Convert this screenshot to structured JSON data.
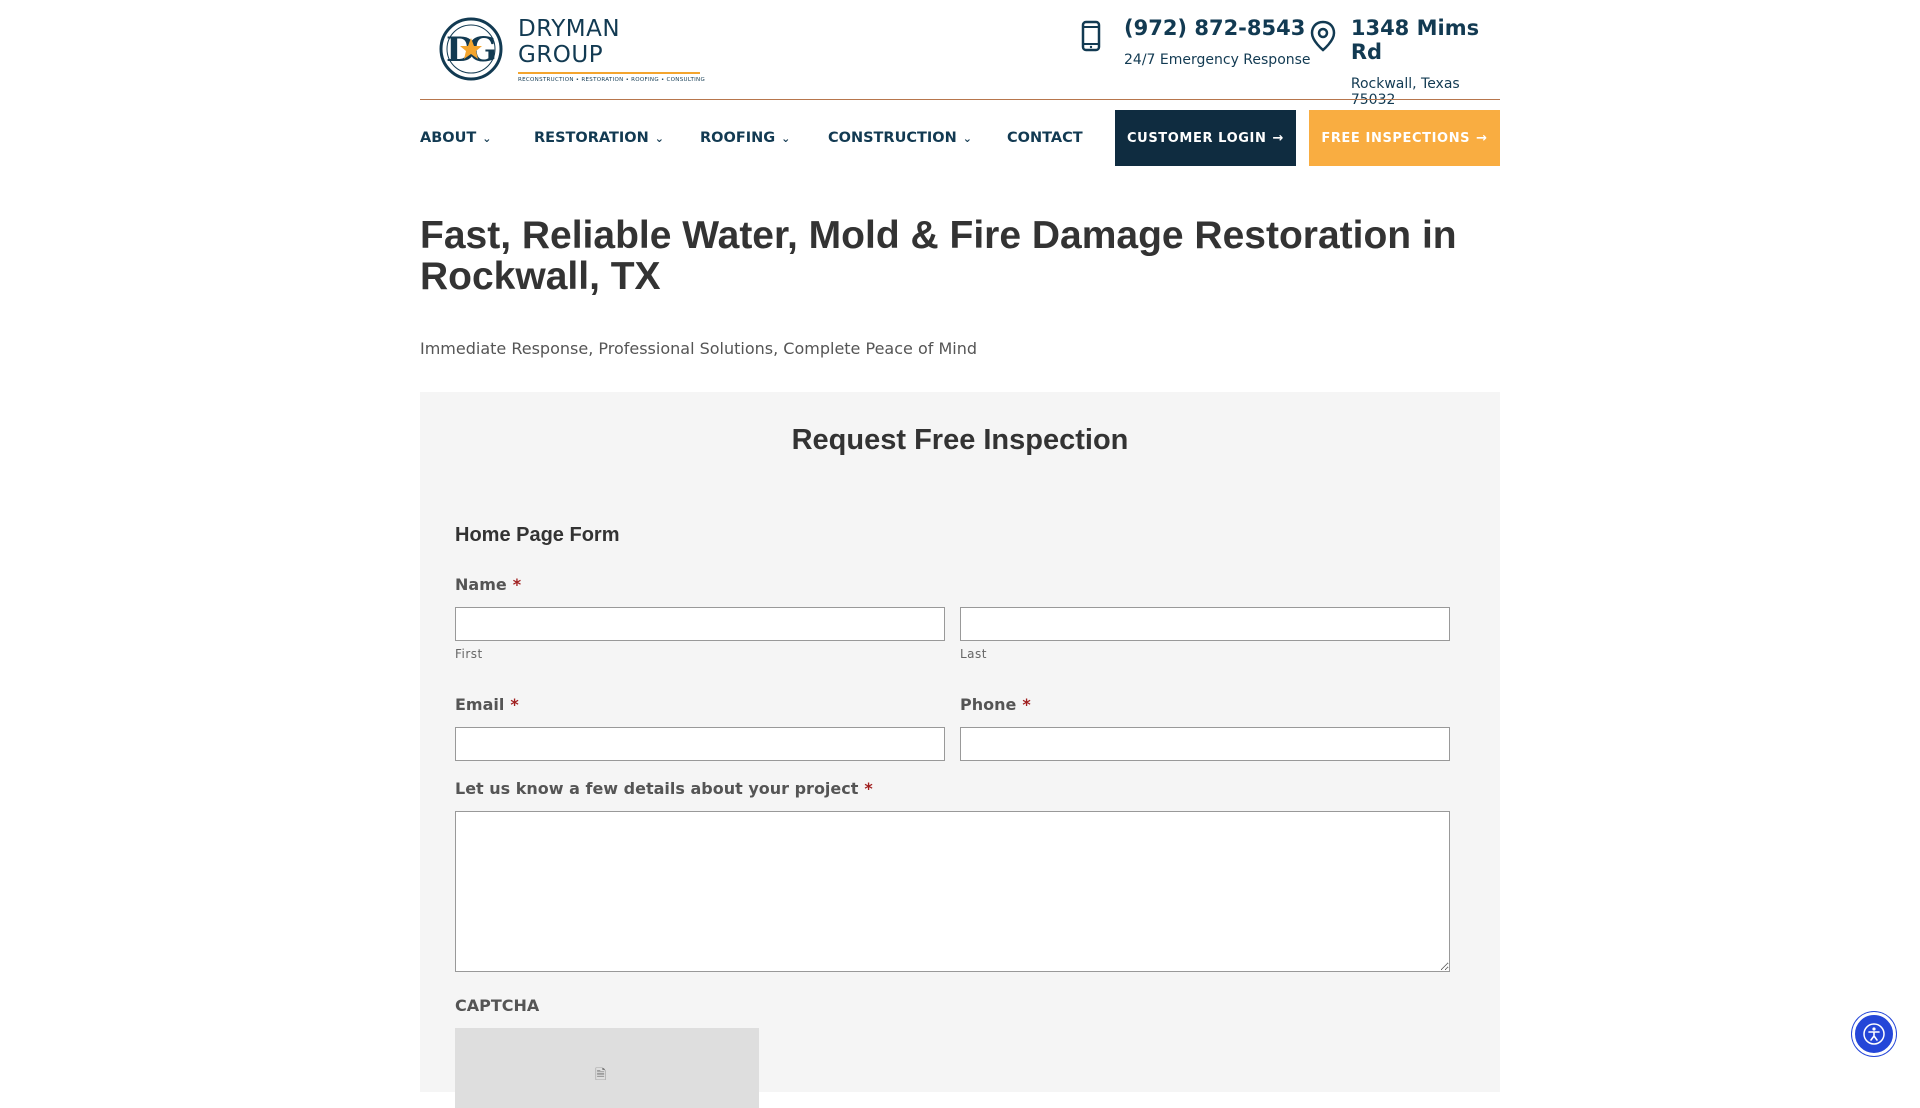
{
  "brand": {
    "name": "DRYMAN GROUP",
    "tagline": "RECONSTRUCTION • RESTORATION • ROOFING • CONSULTING",
    "monogram": "DG",
    "colors": {
      "navy": "#123a52",
      "orange": "#f9ad41",
      "dark_button": "#0f2c40",
      "accessibility_blue": "#2446d8"
    }
  },
  "header": {
    "phone": {
      "number": "(972) 872-8543",
      "sub": "24/7 Emergency Response",
      "icon": "phone-icon"
    },
    "address": {
      "line1": "1348 Mims Rd",
      "line2": "Rockwall, Texas 75032",
      "icon": "map-pin-icon"
    }
  },
  "nav": {
    "items": [
      {
        "label": "ABOUT",
        "has_dropdown": true
      },
      {
        "label": "RESTORATION",
        "has_dropdown": true
      },
      {
        "label": "ROOFING",
        "has_dropdown": true
      },
      {
        "label": "CONSTRUCTION",
        "has_dropdown": true
      },
      {
        "label": "CONTACT",
        "has_dropdown": false
      }
    ],
    "chevron": "⌄",
    "login_button": "CUSTOMER LOGIN",
    "free_button": "FREE INSPECTIONS",
    "arrow": "→"
  },
  "hero": {
    "title": "Fast, Reliable Water, Mold & Fire Damage Restoration in Rockwall, TX",
    "subtitle": "Immediate Response, Professional Solutions, Complete Peace of Mind"
  },
  "form": {
    "panel_title": "Request Free Inspection",
    "form_title": "Home Page Form",
    "required_mark": "*",
    "name_label": "Name",
    "first_sublabel": "First",
    "last_sublabel": "Last",
    "email_label": "Email",
    "phone_label": "Phone",
    "details_label": "Let us know a few details about your project",
    "captcha_label": "CAPTCHA",
    "values": {
      "first": "",
      "last": "",
      "email": "",
      "phone": "",
      "details": ""
    }
  },
  "accessibility_button": {
    "icon": "accessibility-icon"
  }
}
